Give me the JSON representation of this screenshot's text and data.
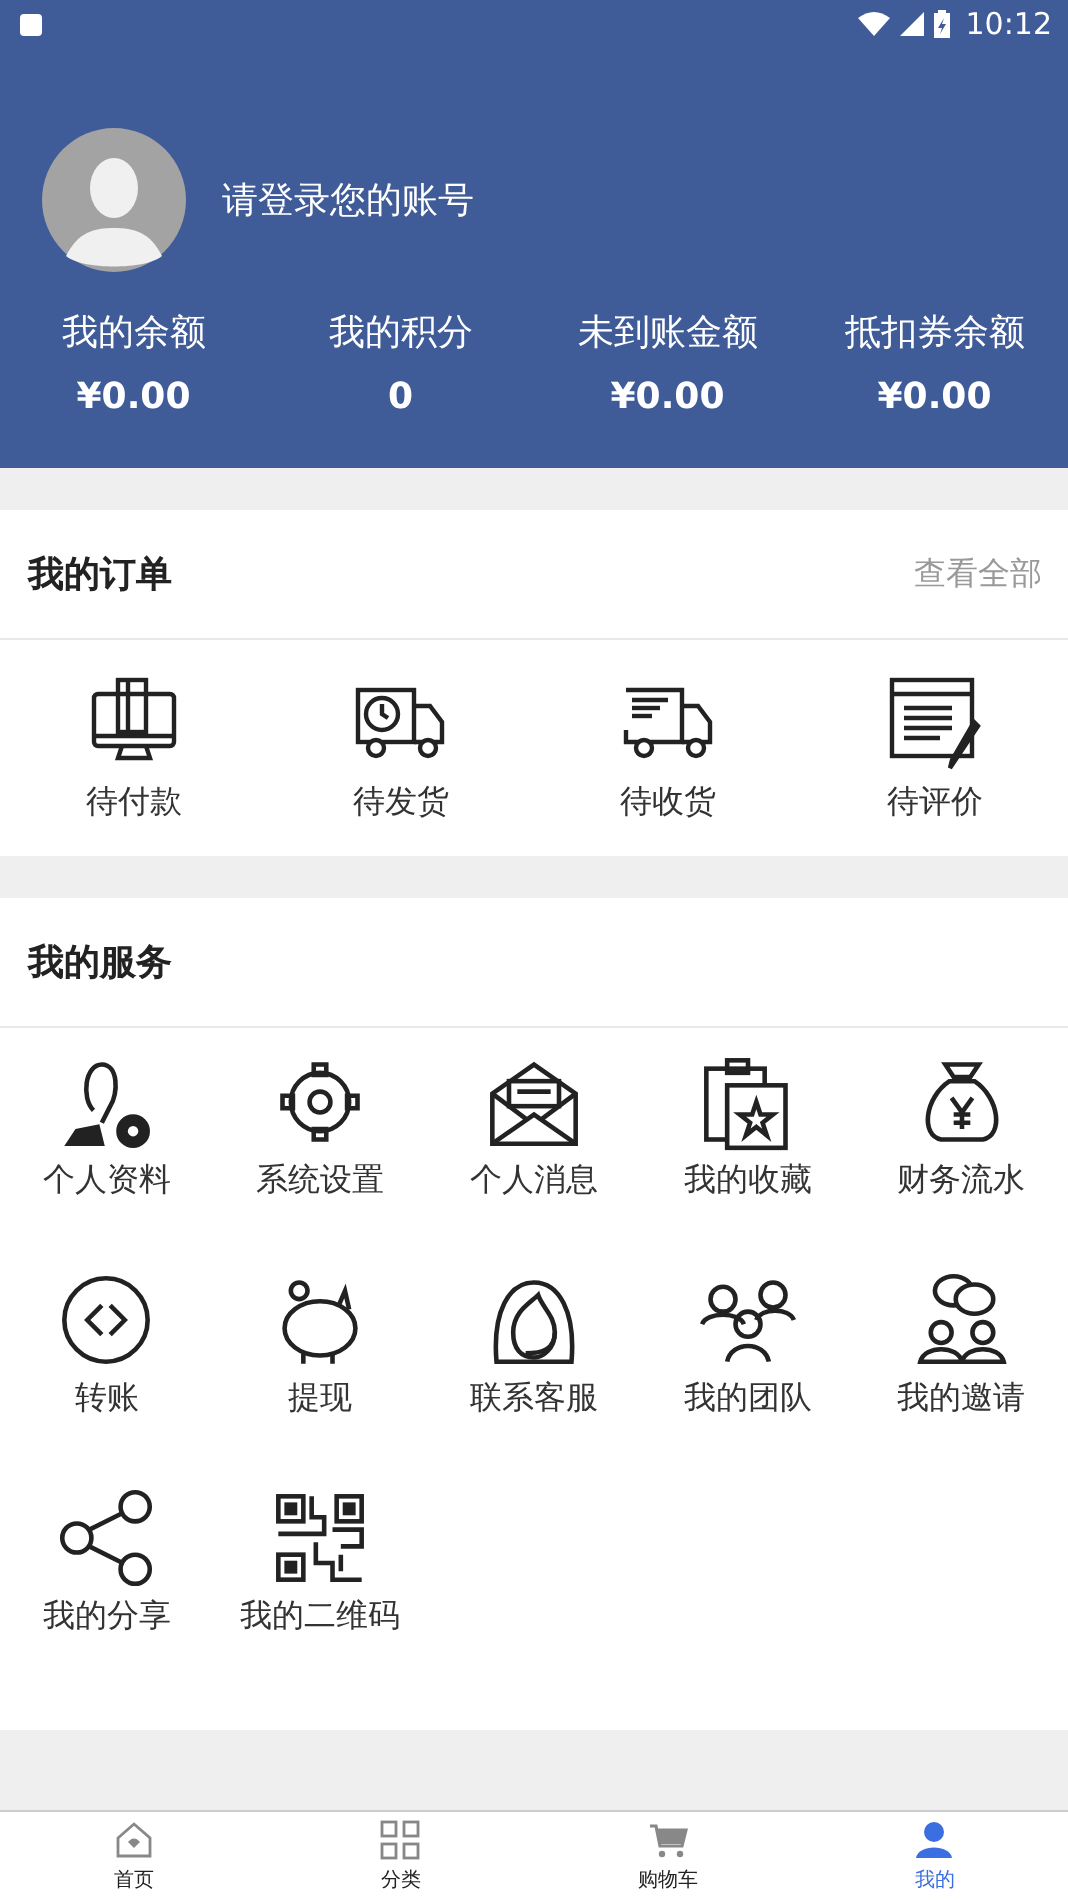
{
  "status_bar": {
    "time": "10:12"
  },
  "profile": {
    "login_prompt": "请登录您的账号"
  },
  "stats": [
    {
      "label": "我的余额",
      "value": "¥0.00"
    },
    {
      "label": "我的积分",
      "value": "0"
    },
    {
      "label": "未到账金额",
      "value": "¥0.00"
    },
    {
      "label": "抵扣券余额",
      "value": "¥0.00"
    }
  ],
  "orders": {
    "title": "我的订单",
    "view_all": "查看全部",
    "items": [
      "待付款",
      "待发货",
      "待收货",
      "待评价"
    ]
  },
  "services": {
    "title": "我的服务",
    "items": [
      "个人资料",
      "系统设置",
      "个人消息",
      "我的收藏",
      "财务流水",
      "转账",
      "提现",
      "联系客服",
      "我的团队",
      "我的邀请",
      "我的分享",
      "我的二维码"
    ]
  },
  "tab_bar": [
    {
      "label": "首页",
      "selected": false
    },
    {
      "label": "分类",
      "selected": false
    },
    {
      "label": "购物车",
      "selected": false
    },
    {
      "label": "我的",
      "selected": true
    }
  ]
}
